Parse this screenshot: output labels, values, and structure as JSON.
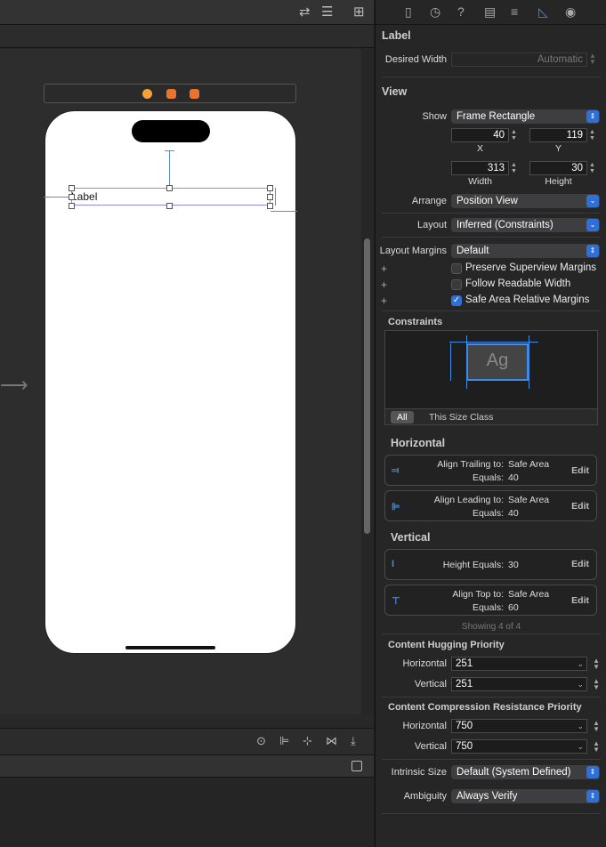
{
  "editor": {
    "scene_title_icons": [
      "view-controller-icon",
      "first-responder-icon",
      "exit-icon"
    ],
    "label_text": "Label",
    "toolbar_icons": [
      "update-frames-icon",
      "align-icon",
      "stack-icon",
      "add-constraints-icon",
      "resolve-issues-icon"
    ]
  },
  "inspector": {
    "label_section": {
      "title": "Label",
      "desired_width_label": "Desired Width",
      "desired_width_value": "Automatic"
    },
    "view_section": {
      "title": "View",
      "show_label": "Show",
      "show_value": "Frame Rectangle",
      "x_value": "40",
      "y_value": "119",
      "x_label": "X",
      "y_label": "Y",
      "width_value": "313",
      "height_value": "30",
      "width_label": "Width",
      "height_label": "Height",
      "arrange_label": "Arrange",
      "arrange_value": "Position View",
      "layout_label": "Layout",
      "layout_value": "Inferred (Constraints)",
      "layout_margins_label": "Layout Margins",
      "layout_margins_value": "Default",
      "preserve_superview": "Preserve Superview Margins",
      "follow_readable": "Follow Readable Width",
      "safe_area_relative": "Safe Area Relative Margins"
    },
    "constraints": {
      "title": "Constraints",
      "preview_text": "Ag",
      "tab_all": "All",
      "tab_size_class": "This Size Class",
      "horizontal_title": "Horizontal",
      "vertical_title": "Vertical",
      "edit_label": "Edit",
      "items": [
        {
          "k1": "Align Trailing to:",
          "v1": "Safe Area",
          "k2": "Equals:",
          "v2": "40"
        },
        {
          "k1": "Align Leading to:",
          "v1": "Safe Area",
          "k2": "Equals:",
          "v2": "40"
        },
        {
          "k1": "Height Equals:",
          "v1": "30"
        },
        {
          "k1": "Align Top to:",
          "v1": "Safe Area",
          "k2": "Equals:",
          "v2": "60"
        }
      ],
      "showing": "Showing 4 of 4"
    },
    "hugging": {
      "title": "Content Hugging Priority",
      "horizontal_label": "Horizontal",
      "horizontal_value": "251",
      "vertical_label": "Vertical",
      "vertical_value": "251"
    },
    "compression": {
      "title": "Content Compression Resistance Priority",
      "horizontal_label": "Horizontal",
      "horizontal_value": "750",
      "vertical_label": "Vertical",
      "vertical_value": "750"
    },
    "intrinsic_label": "Intrinsic Size",
    "intrinsic_value": "Default (System Defined)",
    "ambiguity_label": "Ambiguity",
    "ambiguity_value": "Always Verify"
  }
}
